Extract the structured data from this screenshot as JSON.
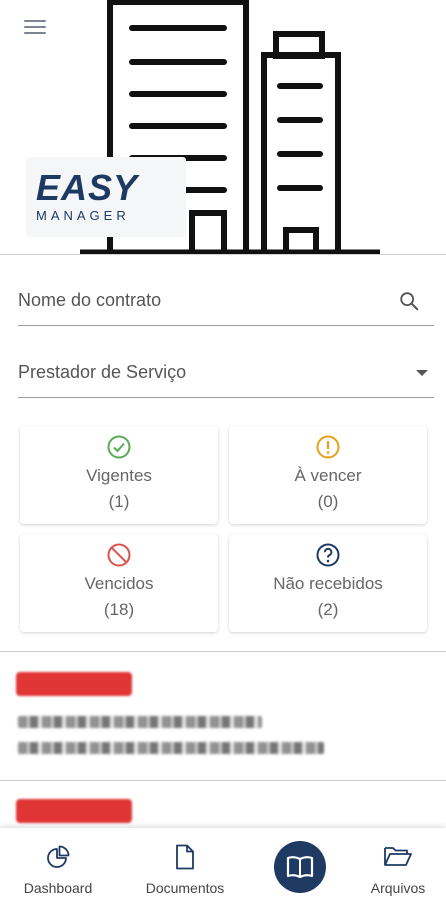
{
  "header": {
    "menu_icon": "hamburger-menu-icon",
    "logo_main": "EASY",
    "logo_sub": "MANAGER",
    "brand_color": "#1e3a63"
  },
  "search": {
    "label": "Nome do contrato",
    "icon": "search-icon"
  },
  "filter": {
    "label": "Prestador de Serviço",
    "icon": "caret-down-icon"
  },
  "status_cards": [
    {
      "title": "Vigentes",
      "count": "(1)",
      "icon": "check-circle-icon",
      "color": "#5aaa55"
    },
    {
      "title": "À vencer",
      "count": "(0)",
      "icon": "exclamation-circle-icon",
      "color": "#e6a019"
    },
    {
      "title": "Vencidos",
      "count": "(18)",
      "icon": "ban-circle-icon",
      "color": "#d9534f"
    },
    {
      "title": "Não recebidos",
      "count": "(2)",
      "icon": "question-circle-icon",
      "color": "#1e3a63"
    }
  ],
  "bottom_nav": {
    "dashboard": "Dashboard",
    "documents": "Documentos",
    "files": "Arquivos",
    "center_icon": "book-icon"
  }
}
